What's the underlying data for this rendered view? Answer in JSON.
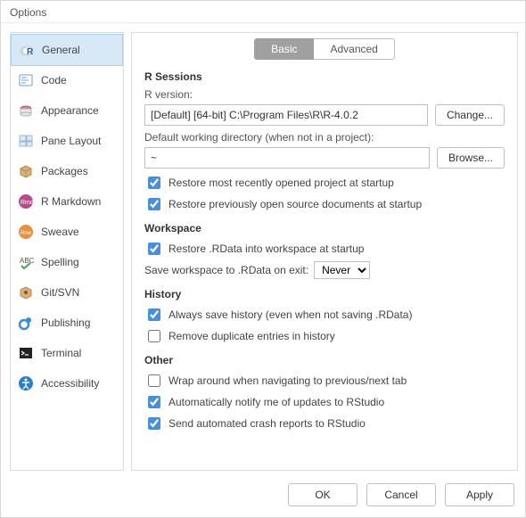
{
  "window": {
    "title": "Options"
  },
  "tabs": {
    "basic": "Basic",
    "advanced": "Advanced"
  },
  "sidebar": {
    "items": [
      {
        "label": "General"
      },
      {
        "label": "Code"
      },
      {
        "label": "Appearance"
      },
      {
        "label": "Pane Layout"
      },
      {
        "label": "Packages"
      },
      {
        "label": "R Markdown"
      },
      {
        "label": "Sweave"
      },
      {
        "label": "Spelling"
      },
      {
        "label": "Git/SVN"
      },
      {
        "label": "Publishing"
      },
      {
        "label": "Terminal"
      },
      {
        "label": "Accessibility"
      }
    ]
  },
  "sessions": {
    "heading": "R Sessions",
    "version_label": "R version:",
    "version_value": "[Default] [64-bit] C:\\Program Files\\R\\R-4.0.2",
    "change_btn": "Change...",
    "wd_label": "Default working directory (when not in a project):",
    "wd_value": "~",
    "browse_btn": "Browse...",
    "restore_project": {
      "label": "Restore most recently opened project at startup",
      "checked": true
    },
    "restore_docs": {
      "label": "Restore previously open source documents at startup",
      "checked": true
    }
  },
  "workspace": {
    "heading": "Workspace",
    "restore_rdata": {
      "label": "Restore .RData into workspace at startup",
      "checked": true
    },
    "save_label": "Save workspace to .RData on exit:",
    "save_value": "Never"
  },
  "history": {
    "heading": "History",
    "always_save": {
      "label": "Always save history (even when not saving .RData)",
      "checked": true
    },
    "remove_dup": {
      "label": "Remove duplicate entries in history",
      "checked": false
    }
  },
  "other": {
    "heading": "Other",
    "wrap_tabs": {
      "label": "Wrap around when navigating to previous/next tab",
      "checked": false
    },
    "auto_notify": {
      "label": "Automatically notify me of updates to RStudio",
      "checked": true
    },
    "crash_reports": {
      "label": "Send automated crash reports to RStudio",
      "checked": true
    }
  },
  "footer": {
    "ok": "OK",
    "cancel": "Cancel",
    "apply": "Apply"
  }
}
